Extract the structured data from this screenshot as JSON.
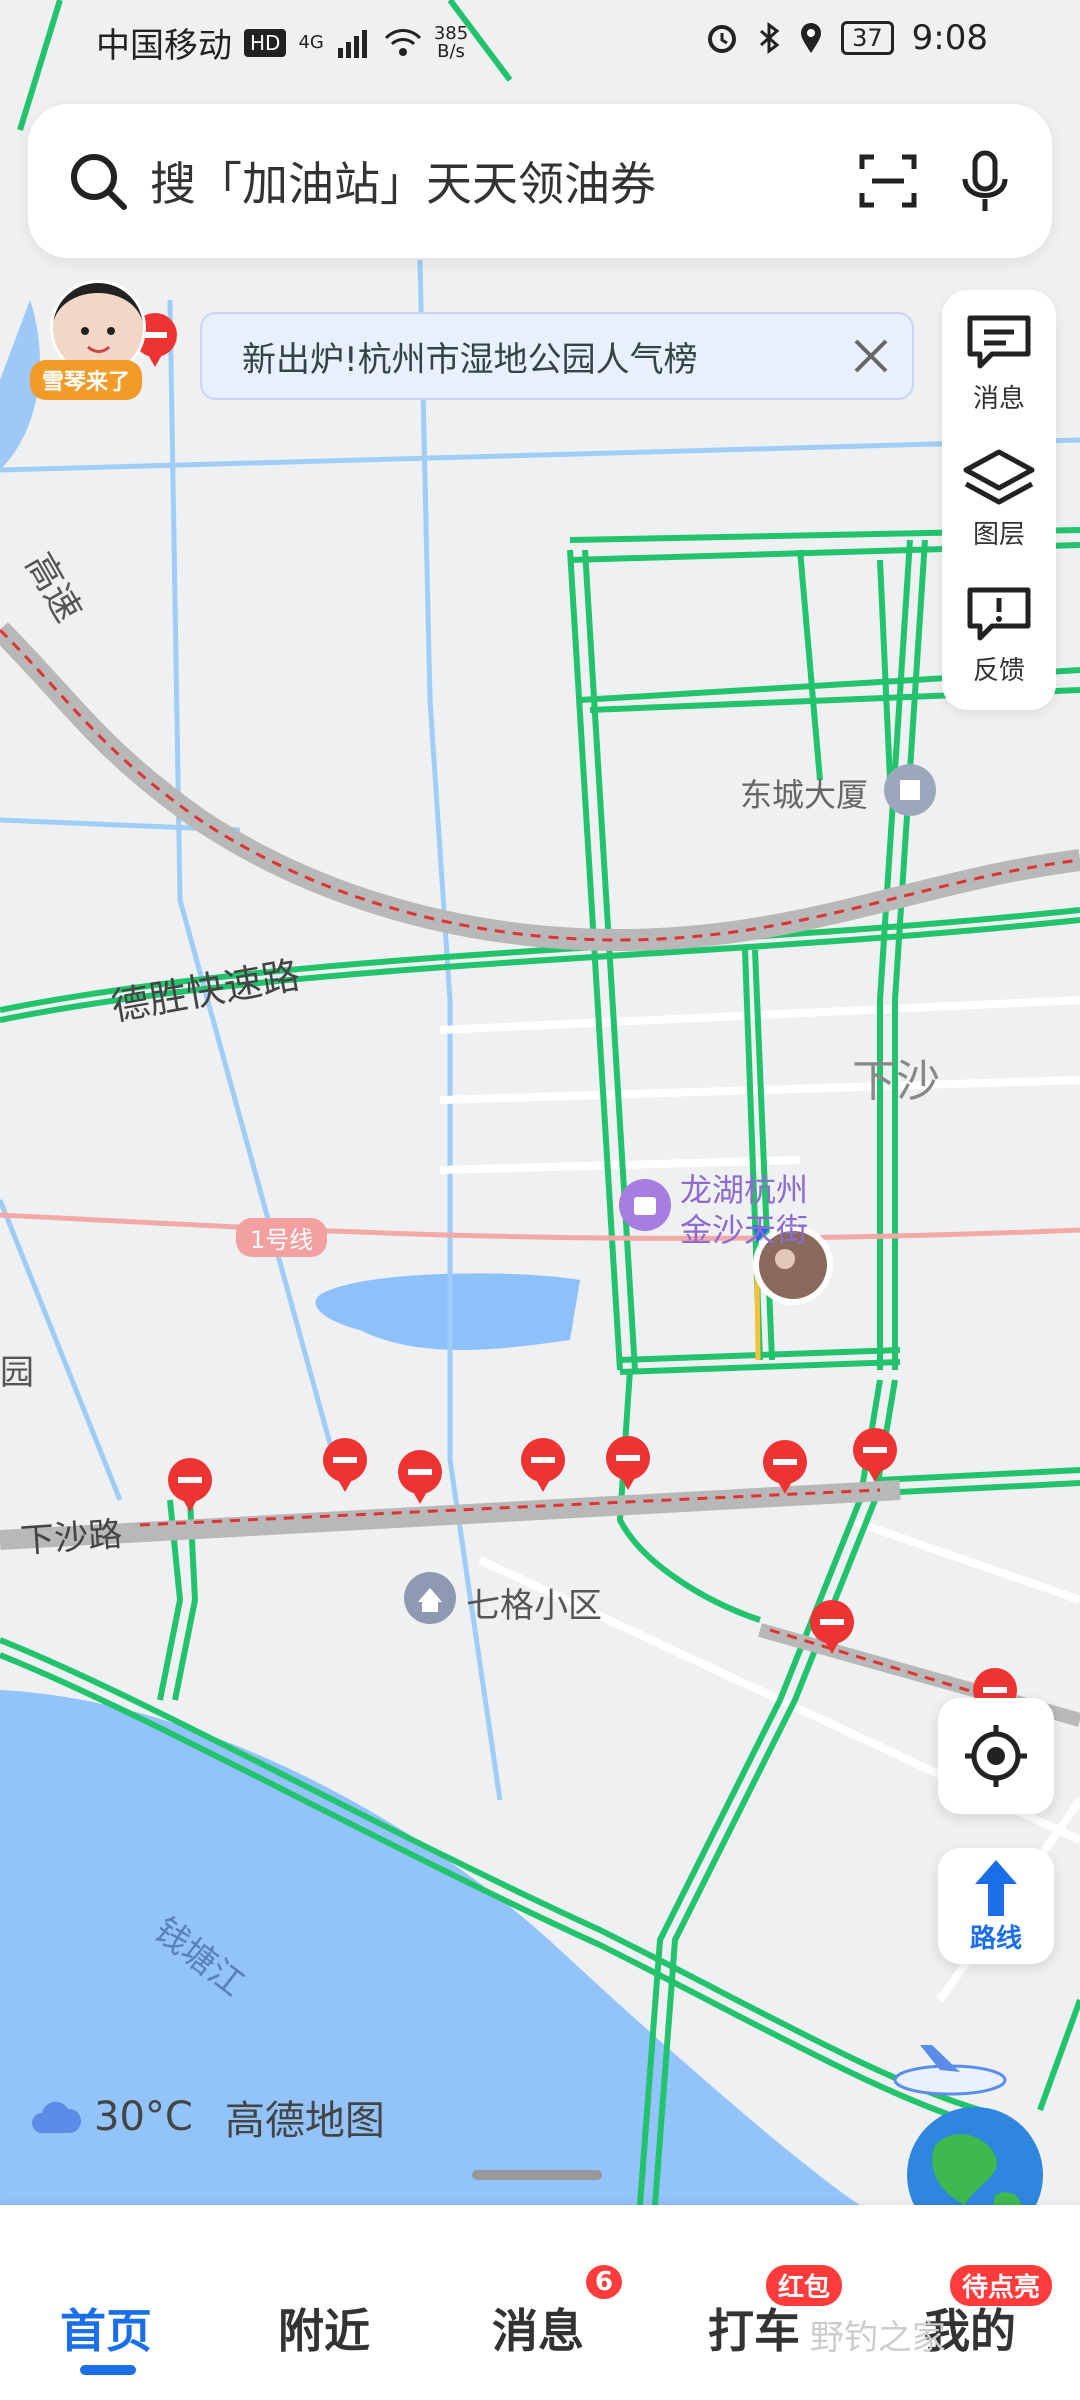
{
  "status_bar": {
    "carrier": "中国移动",
    "hd": "HD",
    "network": "4G",
    "speed_value": "385",
    "speed_unit": "B/s",
    "battery": "37",
    "time": "9:08"
  },
  "search": {
    "placeholder": "搜「加油站」天天领油券"
  },
  "avatar": {
    "label": "雪琴来了"
  },
  "banner": {
    "text": "新出炉!杭州市湿地公园人气榜"
  },
  "side_panel": {
    "items": [
      {
        "label": "消息",
        "icon": "message-icon"
      },
      {
        "label": "图层",
        "icon": "layers-icon"
      },
      {
        "label": "反馈",
        "icon": "feedback-icon"
      }
    ]
  },
  "map": {
    "labels": {
      "expressway": "高速",
      "desheng": "德胜快速路",
      "dongcheng": "东城大厦",
      "xiasha": "下沙",
      "longhu_line1": "龙湖杭州",
      "longhu_line2": "金沙天街",
      "metro": "1号线",
      "xiasha_road": "下沙路",
      "qige": "七格小区",
      "qiantang": "钱塘江",
      "left_edge": "园"
    }
  },
  "route_button": {
    "label": "路线"
  },
  "weather": {
    "temp": "30°C",
    "brand": "高德地图"
  },
  "bottom_nav": {
    "items": [
      {
        "label": "首页",
        "active": true
      },
      {
        "label": "附近"
      },
      {
        "label": "消息",
        "badge": "6"
      },
      {
        "label": "打车",
        "badge": "红包"
      },
      {
        "label": "我的",
        "badge": "待点亮"
      }
    ]
  },
  "watermark": "野钓之家"
}
